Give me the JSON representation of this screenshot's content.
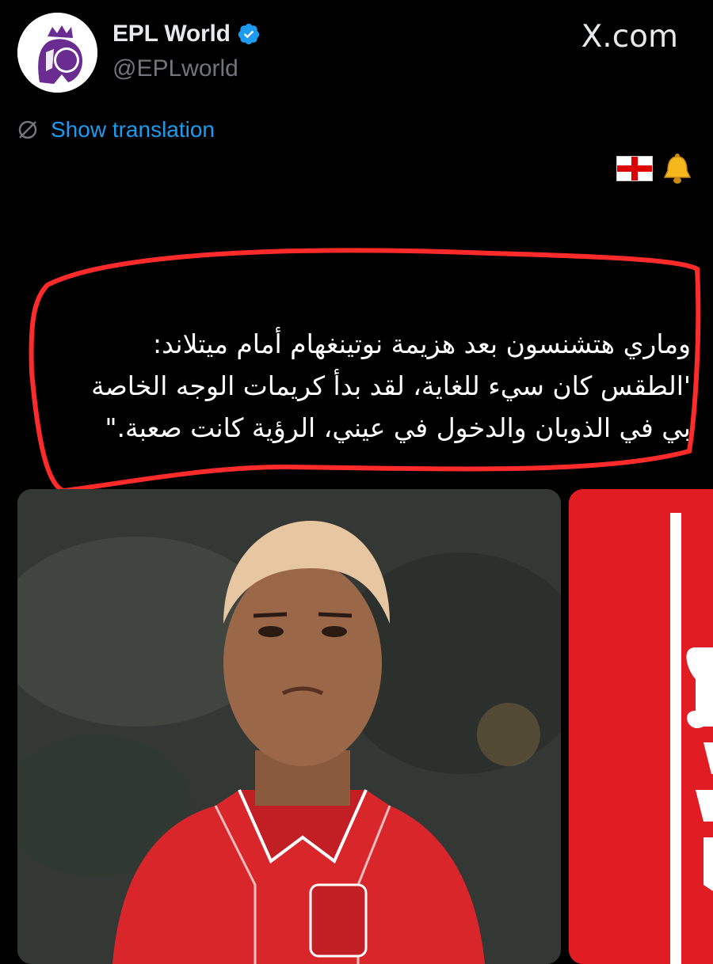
{
  "tweet": {
    "author_name": "EPL World",
    "author_handle": "@EPLworld",
    "brand": "X.com",
    "translate_label": "Show translation",
    "emojis": [
      "england-flag",
      "bell"
    ],
    "body_lines": [
      "وماري هتشنسون بعد هزيمة نوتينغهام أمام ميتلاند:",
      "'الطقس كان سيء للغاية، لقد بدأ كريمات الوجه الخاصة",
      "بي في الذوبان والدخول في عيني، الرؤية كانت صعبة.\""
    ]
  },
  "media": [
    {
      "description_icon": "player-photo",
      "kit_color": "#d9262b"
    },
    {
      "description_icon": "club-crest-panel",
      "color": "#e11c22"
    }
  ],
  "colors": {
    "accent": "#1d9bf0",
    "highlight": "#ff2a2a",
    "background": "#000000"
  }
}
